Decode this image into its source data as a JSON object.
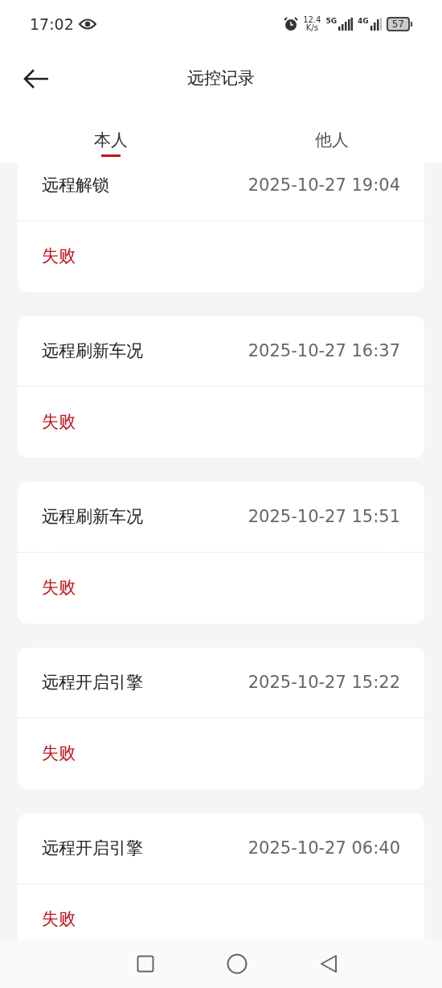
{
  "status_bar": {
    "time": "17:02",
    "speed_value": "12.4",
    "speed_unit": "K/s",
    "network_1": "5G",
    "network_2": "4G",
    "battery": "57"
  },
  "header": {
    "title": "远控记录"
  },
  "tabs": [
    {
      "label": "本人",
      "selected": true
    },
    {
      "label": "他人",
      "selected": false
    }
  ],
  "records": [
    {
      "action": "远程解锁",
      "time": "2025-10-27 19:04",
      "result": "失败"
    },
    {
      "action": "远程刷新车况",
      "time": "2025-10-27 16:37",
      "result": "失败"
    },
    {
      "action": "远程刷新车况",
      "time": "2025-10-27 15:51",
      "result": "失败"
    },
    {
      "action": "远程开启引擎",
      "time": "2025-10-27 15:22",
      "result": "失败"
    },
    {
      "action": "远程开启引擎",
      "time": "2025-10-27 06:40",
      "result": "失败"
    }
  ]
}
